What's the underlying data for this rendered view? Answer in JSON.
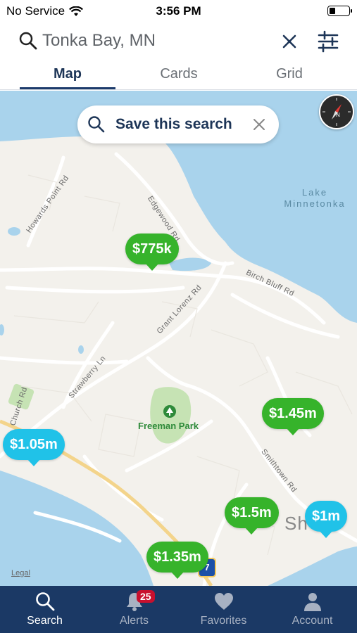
{
  "status_bar": {
    "carrier": "No Service",
    "time": "3:56 PM"
  },
  "search": {
    "query": "Tonka Bay, MN"
  },
  "tabs": [
    {
      "label": "Map",
      "active": true
    },
    {
      "label": "Cards",
      "active": false
    },
    {
      "label": "Grid",
      "active": false
    }
  ],
  "save_search": {
    "label": "Save this search"
  },
  "map": {
    "lake_label": "Lake\nMinnetonka",
    "park_label": "Freeman Park",
    "town_label": "Sh",
    "legal": "Legal",
    "highway_shield": "7",
    "roads": {
      "howards_point": "Howards Point Rd",
      "edgewood": "Edgewood Rd",
      "birch_bluff": "Birch Bluff Rd",
      "grant_lorenz": "Grant Lorenz Rd",
      "strawberry": "Strawberry Ln",
      "church": "Church Rd",
      "smithtown": "Smithtown Rd"
    },
    "pins": [
      {
        "price": "$775k",
        "color": "green"
      },
      {
        "price": "$1.45m",
        "color": "green"
      },
      {
        "price": "$1.05m",
        "color": "blue"
      },
      {
        "price": "$1.5m",
        "color": "green"
      },
      {
        "price": "$1m",
        "color": "blue"
      },
      {
        "price": "$1.35m",
        "color": "green"
      }
    ]
  },
  "tabbar": {
    "items": [
      {
        "label": "Search",
        "icon": "search-icon",
        "active": true
      },
      {
        "label": "Alerts",
        "icon": "bell-icon",
        "badge": "25"
      },
      {
        "label": "Favorites",
        "icon": "heart-icon"
      },
      {
        "label": "Account",
        "icon": "person-icon"
      }
    ]
  },
  "colors": {
    "brand_navy": "#1b3965",
    "pin_green": "#36b32b",
    "pin_blue": "#20c2e8",
    "water": "#a9d3ec",
    "badge_red": "#c8102e"
  }
}
